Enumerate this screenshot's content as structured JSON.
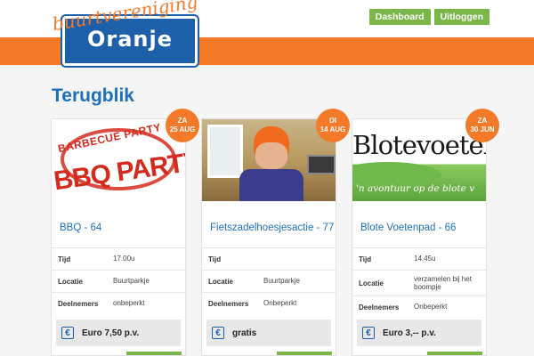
{
  "header": {
    "logo_script": "buurtvereniging",
    "logo_main": "Oranje",
    "nav": [
      {
        "label": "Dashboard"
      },
      {
        "label": "Uitloggen"
      }
    ]
  },
  "page_title": "Terugblik",
  "colors": {
    "accent_orange": "#f47a2a",
    "nav_green": "#7ab648",
    "title_blue": "#1d6fb8",
    "logo_blue": "#1d5fa8"
  },
  "labels": {
    "time": "Tijd",
    "location": "Locatie",
    "participants": "Deelnemers",
    "currency_icon": "€"
  },
  "cards": [
    {
      "badge_day": "ZA",
      "badge_date": "25 AUG",
      "image_text_top": "BARBECUE PARTY",
      "image_text_main": "BBQ PARTY",
      "title": "BBQ - 64",
      "time": "17.00u",
      "location": "Buurtparkje",
      "participants": "onbeperkt",
      "price": "Euro 7,50 p.v."
    },
    {
      "badge_day": "DI",
      "badge_date": "14 AUG",
      "title": "Fietszadelhoesjesactie - 77",
      "time": "",
      "location": "Buurtparkje",
      "participants": "Onbeperkt",
      "price": "gratis"
    },
    {
      "badge_day": "ZA",
      "badge_date": "30 JUN",
      "image_text_top": "Blotevoeten",
      "image_text_main": "'n avontuur op de blote v",
      "title": "Blote Voetenpad - 66",
      "time": "14.45u",
      "location": "verzamelen bij het boompje",
      "participants": "Onbeperkt",
      "price": "Euro 3,-- p.v."
    }
  ]
}
